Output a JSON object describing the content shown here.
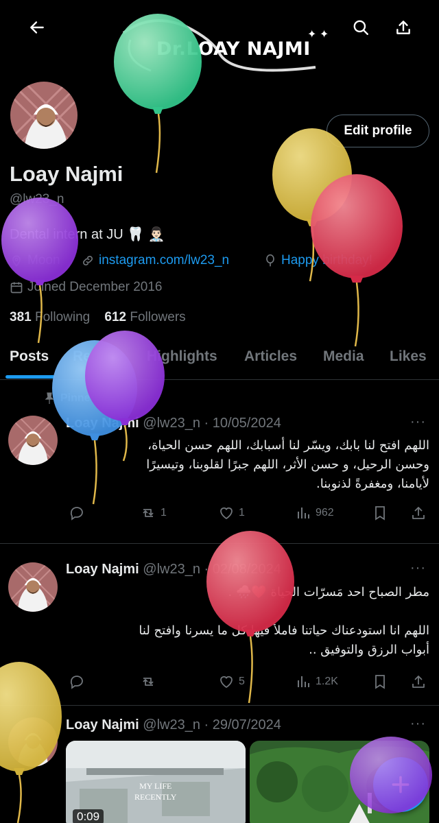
{
  "header": {
    "banner_logo": "Dr.LOAY NAJMI",
    "back_icon": "arrow-left-icon",
    "search_icon": "search-icon",
    "share_icon": "share-icon"
  },
  "profile": {
    "edit_label": "Edit profile",
    "name": "Loay Najmi",
    "handle": "@lw23_n",
    "bio": "Dental intern at JU",
    "bio_emoji": "🦷 👨🏻‍⚕️",
    "location": "Moon",
    "website": "instagram.com/lw23_n",
    "birthday": "Happy birthday!",
    "joined": "Joined December 2016",
    "following_count": "381",
    "following_label": "Following",
    "followers_count": "612",
    "followers_label": "Followers"
  },
  "tabs": [
    "Posts",
    "Replies",
    "Highlights",
    "Articles",
    "Media",
    "Likes"
  ],
  "pinned_label": "Pinned",
  "tweets": [
    {
      "name": "Loay Najmi",
      "meta": "@lw23_n · 10/05/2024",
      "lines": [
        "اللهم افتح لنا بابك، ويسّر لنا أسبابك، اللهم حسن الحياة،",
        "وحسن الرحيل، و حسن الأثر، اللهم جبرًا لقلوبنا، وتيسيرًا",
        "لأيامنا، ومغفرةً لذنوبنا."
      ],
      "retweets": "1",
      "likes": "1",
      "views": "962"
    },
    {
      "name": "Loay Najmi",
      "meta": "@lw23_n · 02/08/2024",
      "lines": [
        "مطر الصباح احد مَسرّات الحياة ❤️🌧️ .",
        "",
        "اللهم انا استودعناك حياتنا فاملأ فيها كل ما يسرنا وافتح لنا",
        "أبواب الرزق والتوفيق .."
      ],
      "retweets": "",
      "likes": "5",
      "views": "1.2K"
    },
    {
      "name": "Loay Najmi",
      "meta": "@lw23_n · 29/07/2024",
      "video_time": "0:09",
      "video_caption_1": "MY LIFE",
      "video_caption_2": "RECENTLY"
    }
  ],
  "colors": {
    "accent": "#1d9bf0",
    "muted": "#71767b",
    "text": "#e7e9ea",
    "border": "#2f3336"
  }
}
